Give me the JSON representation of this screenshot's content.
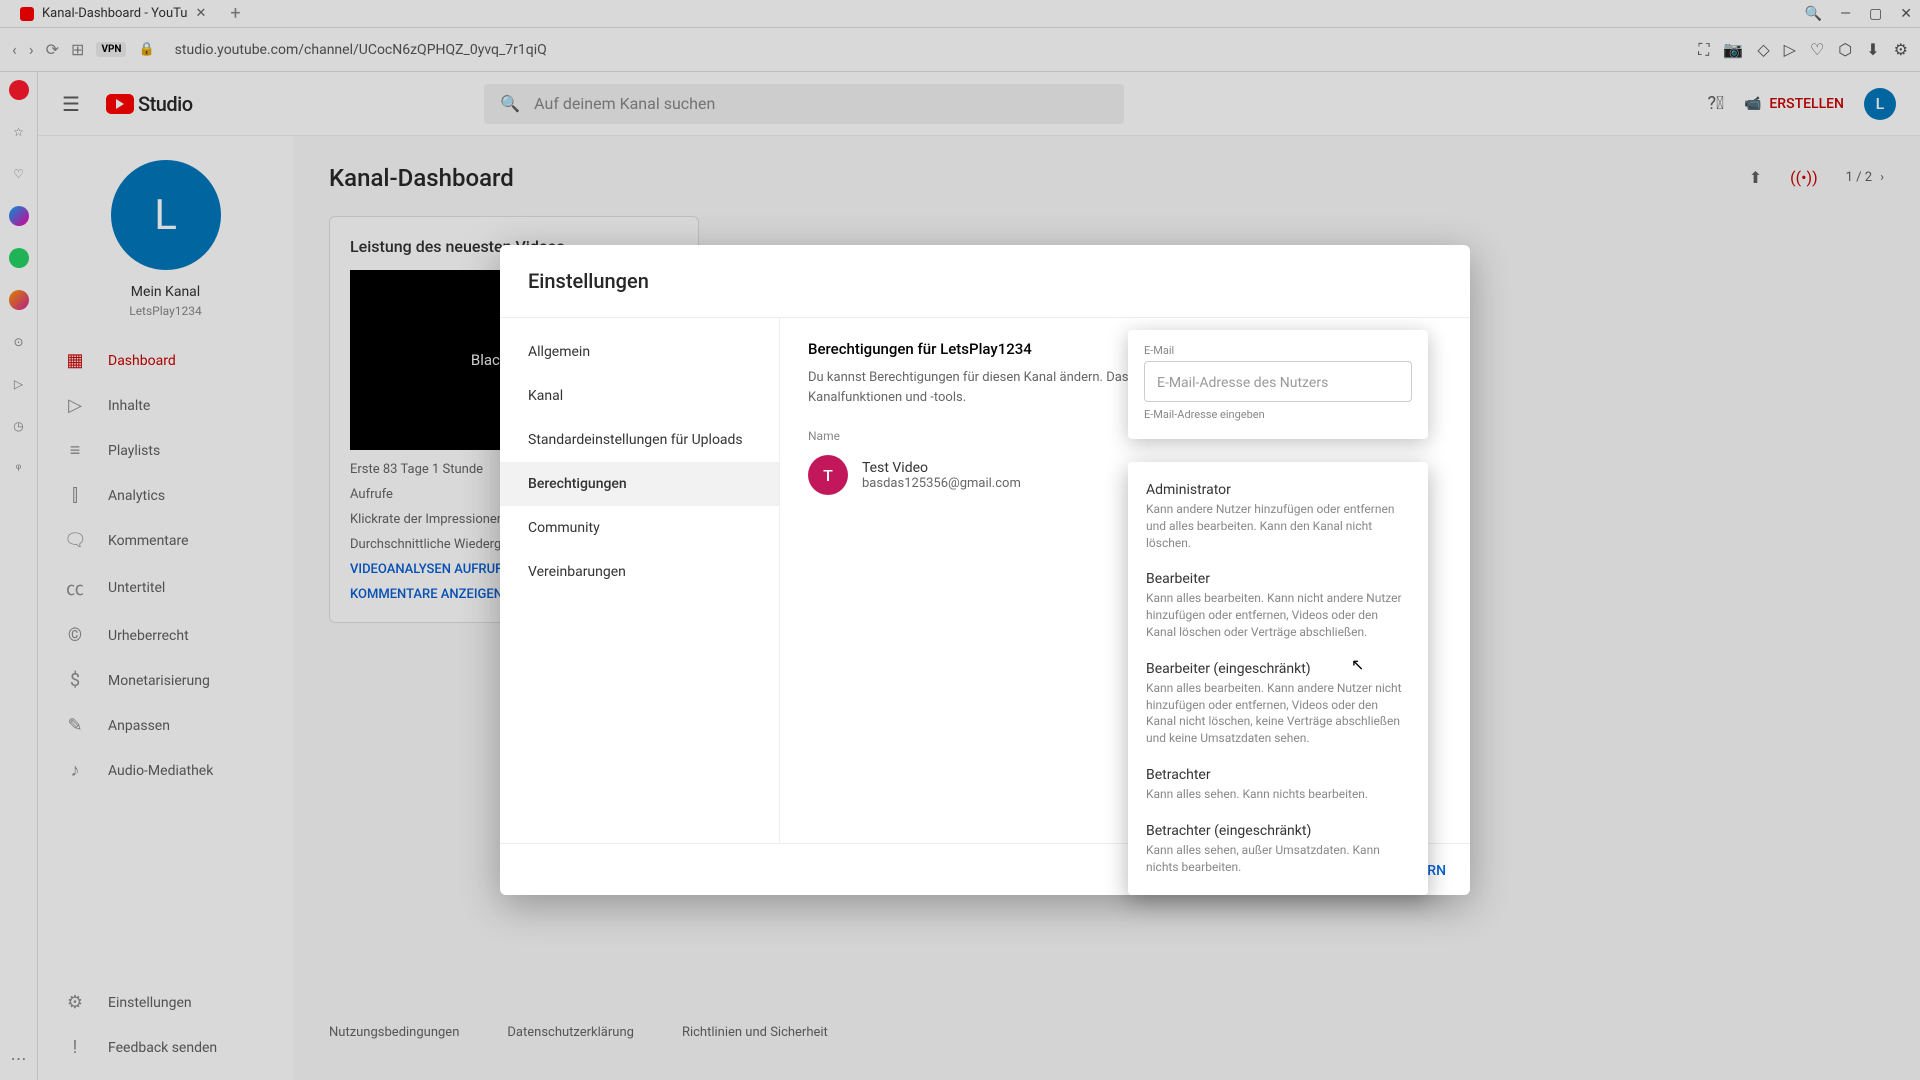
{
  "browser": {
    "tab_title": "Kanal-Dashboard - YouTu",
    "url": "studio.youtube.com/channel/UCocN6zQPHQZ_0yvq_7r1qiQ",
    "vpn": "VPN"
  },
  "header": {
    "logo": "Studio",
    "search_placeholder": "Auf deinem Kanal suchen",
    "create": "ERSTELLEN",
    "avatar_letter": "L"
  },
  "channel": {
    "avatar_letter": "L",
    "label": "Mein Kanal",
    "name": "LetsPlay1234"
  },
  "nav": {
    "items": [
      {
        "label": "Dashboard",
        "icon": "▦"
      },
      {
        "label": "Inhalte",
        "icon": "▷"
      },
      {
        "label": "Playlists",
        "icon": "≡"
      },
      {
        "label": "Analytics",
        "icon": "⫿"
      },
      {
        "label": "Kommentare",
        "icon": "🗨"
      },
      {
        "label": "Untertitel",
        "icon": "㏄"
      },
      {
        "label": "Urheberrecht",
        "icon": "©"
      },
      {
        "label": "Monetarisierung",
        "icon": "$"
      },
      {
        "label": "Anpassen",
        "icon": "✎"
      },
      {
        "label": "Audio-Mediathek",
        "icon": "♪"
      }
    ],
    "bottom": [
      {
        "label": "Einstellungen",
        "icon": "⚙"
      },
      {
        "label": "Feedback senden",
        "icon": "!"
      }
    ]
  },
  "page": {
    "title": "Kanal-Dashboard",
    "pager": "1 / 2",
    "perf_card": {
      "title": "Leistung des neuesten Videos",
      "thumb_text": "Black Screen",
      "duration_line": "Erste 83 Tage 1 Stunde",
      "row1": "Aufrufe",
      "row2": "Klickrate der Impressionen",
      "row3": "Durchschnittliche Wiedergabe",
      "link1": "VIDEOANALYSEN AUFRUFEN",
      "link2": "KOMMENTARE ANZEIGEN"
    }
  },
  "footer": {
    "a": "Nutzungsbedingungen",
    "b": "Datenschutzerklärung",
    "c": "Richtlinien und Sicherheit"
  },
  "modal": {
    "title": "Einstellungen",
    "side": [
      "Allgemein",
      "Kanal",
      "Standardeinstellungen für Uploads",
      "Berechtigungen",
      "Community",
      "Vereinbarungen"
    ],
    "content_title": "Berechtigungen für LetsPlay1234",
    "content_desc": "Du kannst Berechtigungen für diesen Kanal ändern. Das funktioniert momentan noch nicht für alle Kanalfunktionen und -tools.",
    "name_label": "Name",
    "user": {
      "letter": "T",
      "name": "Test Video",
      "email": "basdas125356@gmail.com"
    },
    "save": "SPEICHERN"
  },
  "invite": {
    "email_label": "E-Mail",
    "email_placeholder": "E-Mail-Adresse des Nutzers",
    "hint": "E-Mail-Adresse eingeben"
  },
  "roles": [
    {
      "title": "Administrator",
      "desc": "Kann andere Nutzer hinzufügen oder entfernen und alles bearbeiten. Kann den Kanal nicht löschen."
    },
    {
      "title": "Bearbeiter",
      "desc": "Kann alles bearbeiten. Kann nicht andere Nutzer hinzufügen oder entfernen, Videos oder den Kanal löschen oder Verträge abschließen."
    },
    {
      "title": "Bearbeiter (eingeschränkt)",
      "desc": "Kann alles bearbeiten. Kann andere Nutzer nicht hinzufügen oder entfernen, Videos oder den Kanal nicht löschen, keine Verträge abschließen und keine Umsatzdaten sehen."
    },
    {
      "title": "Betrachter",
      "desc": "Kann alles sehen. Kann nichts bearbeiten."
    },
    {
      "title": "Betrachter (eingeschränkt)",
      "desc": "Kann alles sehen, außer Umsatzdaten. Kann nichts bearbeiten."
    }
  ]
}
